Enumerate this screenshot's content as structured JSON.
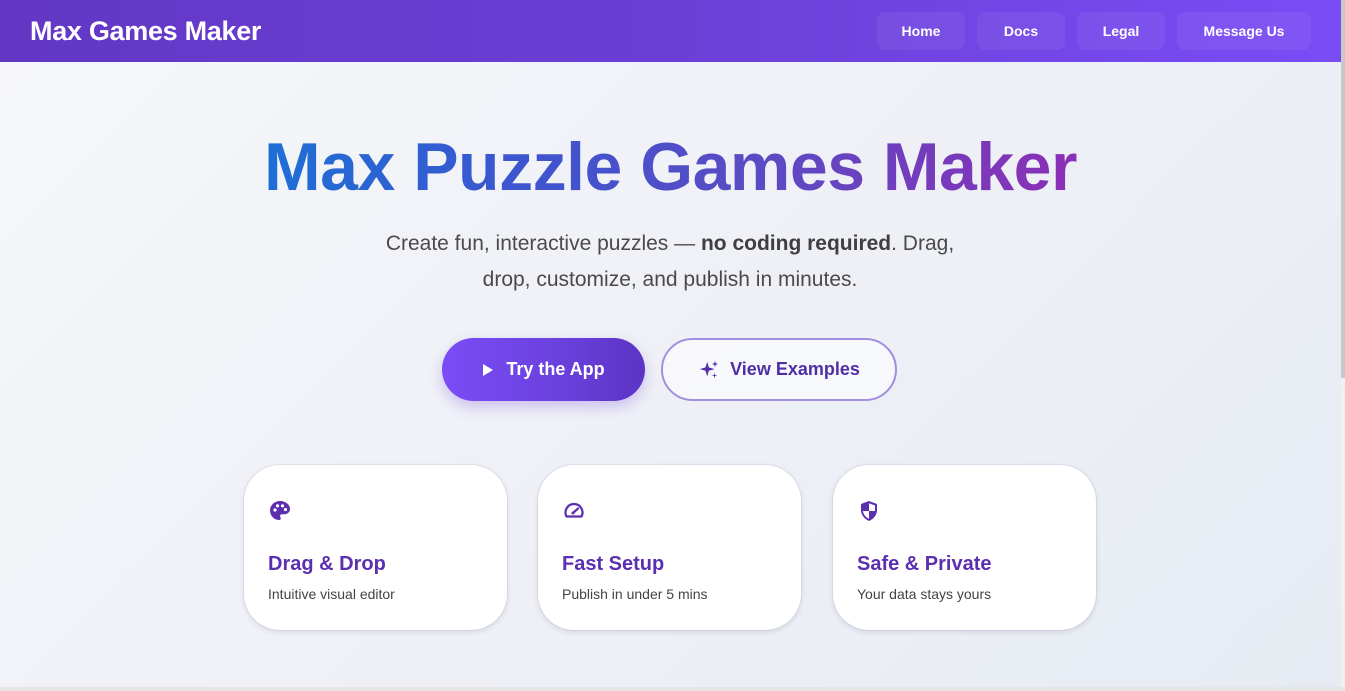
{
  "header": {
    "brand": "Max Games Maker",
    "nav": [
      {
        "label": "Home"
      },
      {
        "label": "Docs"
      },
      {
        "label": "Legal"
      },
      {
        "label": "Message Us"
      }
    ]
  },
  "hero": {
    "title": "Max Puzzle Games Maker",
    "subtitle_before": "Create fun, interactive puzzles — ",
    "subtitle_bold": "no coding required",
    "subtitle_after": ". Drag, drop, customize, and publish in minutes.",
    "primary_button": {
      "label": "Try the App",
      "icon": "play-icon"
    },
    "secondary_button": {
      "label": "View Examples",
      "icon": "sparkles-icon"
    }
  },
  "features": [
    {
      "icon": "palette-icon",
      "title": "Drag & Drop",
      "description": "Intuitive visual editor"
    },
    {
      "icon": "speedometer-icon",
      "title": "Fast Setup",
      "description": "Publish in under 5 mins"
    },
    {
      "icon": "shield-icon",
      "title": "Safe & Private",
      "description": "Your data stays yours"
    }
  ],
  "colors": {
    "header_gradient_start": "#6337c4",
    "header_gradient_end": "#7a4cf6",
    "accent_purple": "#5b2fb0",
    "title_gradient_start": "#1e6fd6",
    "title_gradient_end": "#8b2fb6"
  }
}
